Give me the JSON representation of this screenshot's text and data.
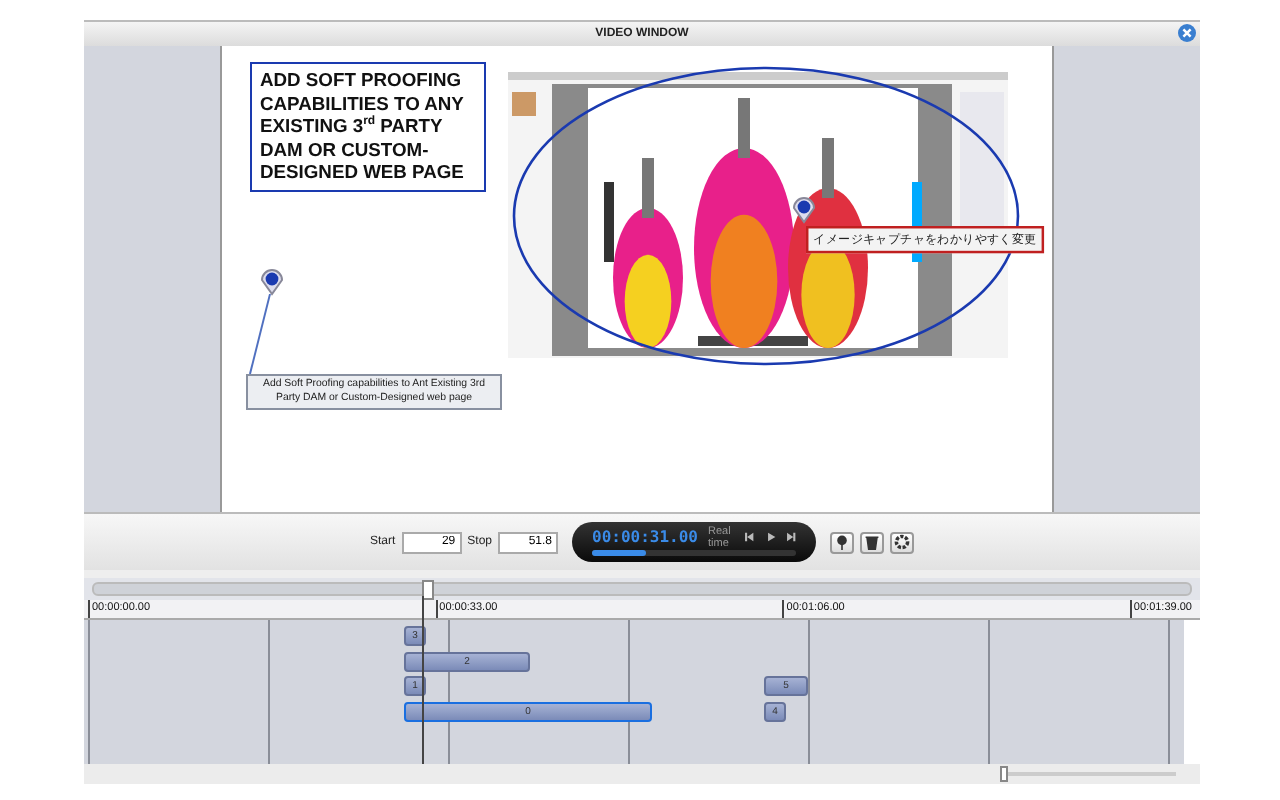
{
  "window": {
    "title": "VIDEO WINDOW"
  },
  "slide": {
    "heading": "ADD SOFT PROOFING CAPABILITIES TO ANY EXISTING 3$^{rd}$ PARTY DAM OR CUSTOM-DESIGNED WEB PAGE",
    "caption": "Add Soft Proofing capabilities to Ant Existing 3rd Party DAM or Custom-Designed web page",
    "callout": "イメージキャプチャをわかりやすく変更"
  },
  "controls": {
    "start_label": "Start",
    "start_value": "29",
    "stop_label": "Stop",
    "stop_value": "51.8",
    "timecode": "00:00:31.00",
    "mode": "Real time",
    "progress": {
      "level": 0.26
    }
  },
  "timeline": {
    "scrubber": {
      "level": 0.305
    },
    "ticks": [
      "00:00:00.00",
      "00:00:33.00",
      "00:01:06.00",
      "00:01:39.00"
    ],
    "clips": [
      {
        "label": "3",
        "selected": false
      },
      {
        "label": "2",
        "selected": false
      },
      {
        "label": "1",
        "selected": false
      },
      {
        "label": "5",
        "selected": false
      },
      {
        "label": "0",
        "selected": true
      },
      {
        "label": "4",
        "selected": false
      }
    ],
    "zoom": {
      "level": 0
    }
  }
}
